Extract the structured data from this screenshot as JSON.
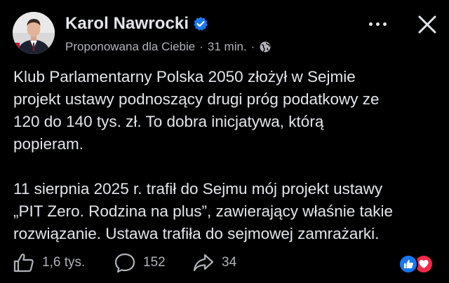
{
  "post": {
    "author": "Karol Nawrocki",
    "suggested_label": "Proponowana dla Ciebie",
    "separator": "·",
    "time_ago": "31 min.",
    "paragraph1_line1": "Klub Parlamentarny Polska 2050 złożył w Sejmie",
    "paragraph1_line2": "projekt ustawy podnoszący drugi próg podatkowy ze",
    "paragraph1_line3": "120 do 140 tys. zł. To dobra inicjatywa, którą",
    "paragraph1_line4": "popieram.",
    "paragraph2_line1": "11 sierpnia 2025 r. trafił do Sejmu mój projekt ustawy",
    "paragraph2_line2": "„PIT Zero. Rodzina na plus”, zawierający właśnie takie",
    "paragraph2_line3": "rozwiązanie. Ustawa trafiła do sejmowej zamrażarki."
  },
  "actions": {
    "likes": "1,6 tys.",
    "comments": "152",
    "shares": "34"
  },
  "icons": {
    "verified": "verified-badge-icon",
    "globe": "globe-icon",
    "more": "more-options-icon",
    "close": "close-icon",
    "like": "thumbs-up-icon",
    "comment": "comment-bubble-icon",
    "share": "share-arrow-icon",
    "reaction_like": "like-reaction-icon",
    "reaction_love": "love-reaction-icon"
  },
  "colors": {
    "background": "#000000",
    "text_primary": "#e4e6eb",
    "text_secondary": "#b0b3b8",
    "verified_blue": "#1877f2",
    "love_red": "#f0284a"
  }
}
